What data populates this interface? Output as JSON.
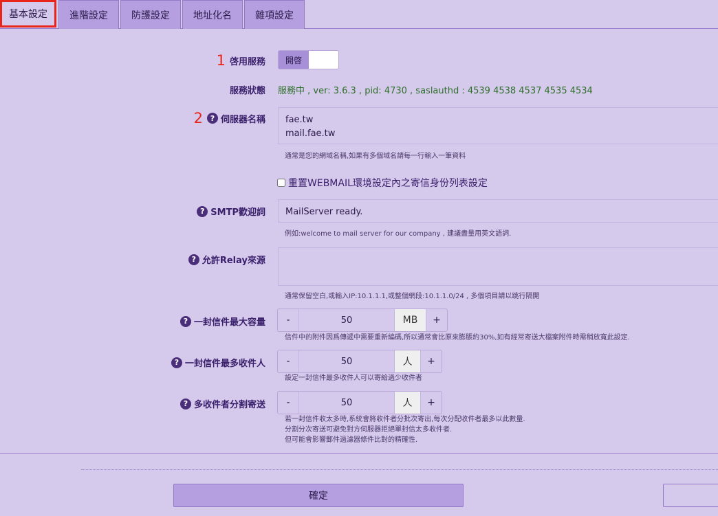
{
  "tabs": [
    "基本設定",
    "進階設定",
    "防護設定",
    "地址化名",
    "雜項設定"
  ],
  "enable_service": {
    "number": "1",
    "label": "啓用服務",
    "toggle_on_label": "開啓"
  },
  "service_status": {
    "label": "服務狀態",
    "value": "服務中 , ver: 3.6.3 , pid: 4730 , saslauthd : 4539 4538 4537 4535 4534"
  },
  "hostname": {
    "number": "2",
    "label": "伺服器名稱",
    "value": "fae.tw\nmail.fae.tw",
    "hint": "通常是您的網域名稱,如果有多個域名請每一行輸入一筆資料"
  },
  "reset_checkbox": {
    "label": "重置WEBMAIL環境設定內之寄信身份列表設定",
    "checked": false
  },
  "smtp_welcome": {
    "label": "SMTP歡迎詞",
    "value": "MailServer ready.",
    "hint": "例如:welcome to mail server for our company , 建議盡量用英文語詞."
  },
  "relay": {
    "label": "允許Relay來源",
    "value": "",
    "hint": "通常保留空白,或輸入IP:10.1.1.1,或整個網段:10.1.1.0/24 , 多個項目請以跳行隔開"
  },
  "max_size": {
    "label": "一封信件最大容量",
    "minus": "-",
    "plus": "+",
    "value": "50",
    "unit": "MB",
    "hint": "信件中的附件因爲傳遞中需要重新編碼,所以通常會比原來膨脹約30%,如有經常寄送大檔案附件時需稍放寬此設定."
  },
  "max_recipients": {
    "label": "一封信件最多收件人",
    "minus": "-",
    "plus": "+",
    "value": "50",
    "unit": "人",
    "hint": "設定一封信件最多收件人可以寄給過少收件者"
  },
  "split_send": {
    "label": "多收件者分割寄送",
    "minus": "-",
    "plus": "+",
    "value": "50",
    "unit": "人",
    "hint": "若一封信件收太多時,系統會將收件者分批次寄出,每次分配收件者最多以此數量.\n分割分次寄送可避免對方伺服器拒絕單封信太多收件者.\n但可能會影響郵件過濾器條件比對的精確性."
  },
  "question_icon_glyph": "?",
  "confirm_label": "確定",
  "colors": {
    "accent_red": "#e8251a",
    "status_green": "#2f6f2a",
    "bg": "#d5c9ec",
    "tab_bg": "#b69fe0"
  }
}
